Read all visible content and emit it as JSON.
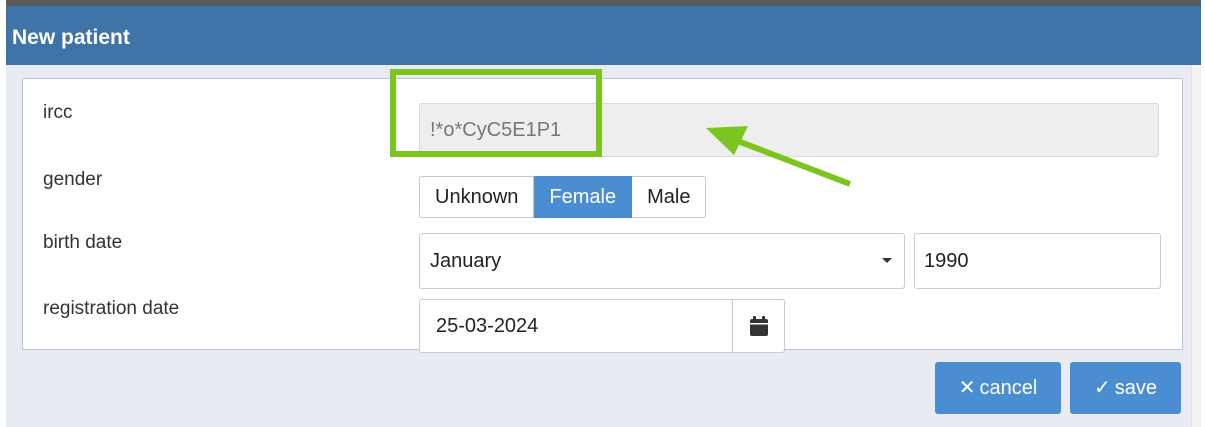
{
  "dialog": {
    "title": "New patient"
  },
  "form": {
    "ircc": {
      "label": "ircc",
      "value": "!*o*CyC5E1P1"
    },
    "gender": {
      "label": "gender",
      "options": [
        "Unknown",
        "Female",
        "Male"
      ],
      "selected": "Female"
    },
    "birth_date": {
      "label": "birth date",
      "month": "January",
      "year": "1990"
    },
    "registration_date": {
      "label": "registration date",
      "value": "25-03-2024",
      "icon": "calendar-icon"
    }
  },
  "footer": {
    "cancel_label": "cancel",
    "save_label": "save",
    "cancel_icon": "close-icon",
    "save_icon": "check-icon"
  },
  "colors": {
    "titlebar": "#3f74a8",
    "accent": "#4a8dd1",
    "highlight": "#7cc520"
  }
}
